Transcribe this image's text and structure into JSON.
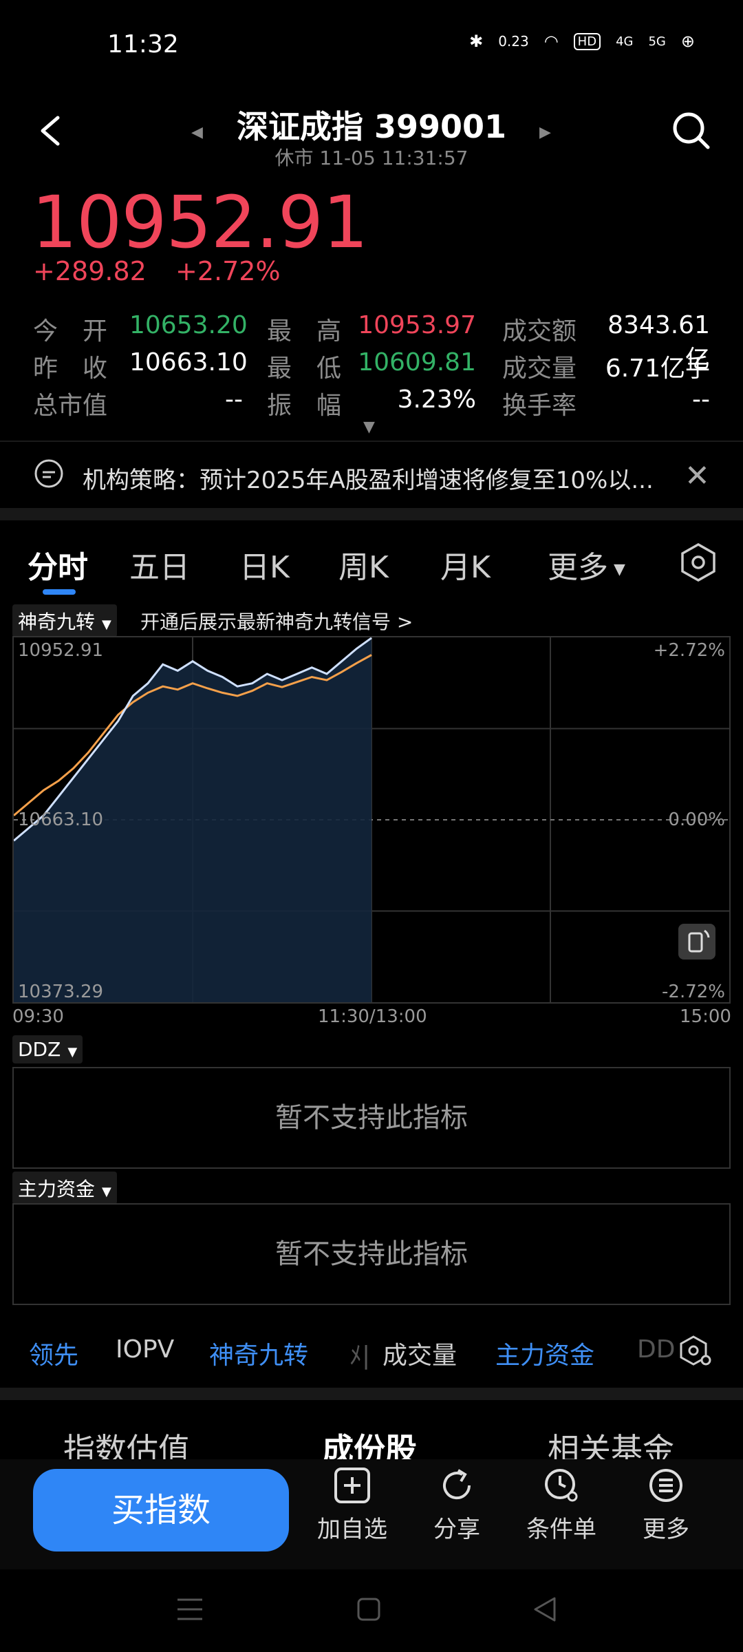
{
  "status_bar": {
    "time": "11:32",
    "speed": "0.23",
    "hd": "HD",
    "net1": "4G",
    "net2": "5G"
  },
  "header": {
    "title": "深证成指 399001",
    "subtitle": "休市  11-05 11:31:57"
  },
  "quote": {
    "price": "10952.91",
    "change": "+289.82",
    "change_pct": "+2.72%",
    "rows": [
      [
        {
          "label": "今　开",
          "value": "10653.20",
          "color": "green"
        },
        {
          "label": "最　高",
          "value": "10953.97",
          "color": "red"
        },
        {
          "label": "成交额",
          "value": "8343.61亿",
          "color": "white"
        }
      ],
      [
        {
          "label": "昨　收",
          "value": "10663.10",
          "color": "white"
        },
        {
          "label": "最　低",
          "value": "10609.81",
          "color": "green"
        },
        {
          "label": "成交量",
          "value": "6.71亿手",
          "color": "white"
        }
      ],
      [
        {
          "label": "总市值",
          "value": "--",
          "color": "white"
        },
        {
          "label": "振　幅",
          "value": "3.23%",
          "color": "white"
        },
        {
          "label": "换手率",
          "value": "--",
          "color": "white"
        }
      ]
    ]
  },
  "news": {
    "text": "机构策略：预计2025年A股盈利增速将修复至10%以..."
  },
  "tabs": [
    "分时",
    "五日",
    "日K",
    "周K",
    "月K",
    "更多"
  ],
  "indicator_bar": {
    "chip": "神奇九转",
    "promo": "开通后展示最新神奇九转信号 >"
  },
  "chart_data": {
    "type": "line",
    "y_left_labels": [
      "10952.91",
      "10663.10",
      "10373.29"
    ],
    "y_right_labels": [
      "+2.72%",
      "0.00%",
      "-2.72%"
    ],
    "x_labels": [
      "09:30",
      "11:30/13:00",
      "15:00"
    ],
    "ylim": [
      10373.29,
      10952.91
    ],
    "baseline": 10663.1,
    "session_fraction": 0.5,
    "series": [
      {
        "color": "#cfe0ff",
        "values": [
          10630,
          10650,
          10670,
          10700,
          10730,
          10760,
          10790,
          10820,
          10860,
          10880,
          10910,
          10900,
          10915,
          10900,
          10890,
          10875,
          10880,
          10895,
          10885,
          10895,
          10905,
          10895,
          10915,
          10935,
          10952
        ]
      },
      {
        "color": "#f5a04a",
        "values": [
          10670,
          10690,
          10710,
          10725,
          10745,
          10770,
          10800,
          10830,
          10850,
          10865,
          10875,
          10870,
          10880,
          10872,
          10865,
          10860,
          10868,
          10880,
          10874,
          10882,
          10890,
          10885,
          10898,
          10912,
          10925
        ]
      }
    ]
  },
  "ddz": {
    "chip": "DDZ",
    "message": "暂不支持此指标"
  },
  "main_fund": {
    "chip": "主力资金",
    "message": "暂不支持此指标"
  },
  "indicator_tabs": [
    "领先",
    "IOPV",
    "神奇九转",
    "成交量",
    "主力资金",
    "DD"
  ],
  "sub_tabs": [
    "指数估值",
    "成份股",
    "相关基金"
  ],
  "action_bar": {
    "buy": "买指数",
    "items": [
      "加自选",
      "分享",
      "条件单",
      "更多"
    ]
  },
  "colors": {
    "accent": "#2f86f6",
    "up": "#f0455a",
    "down": "#33b266"
  }
}
